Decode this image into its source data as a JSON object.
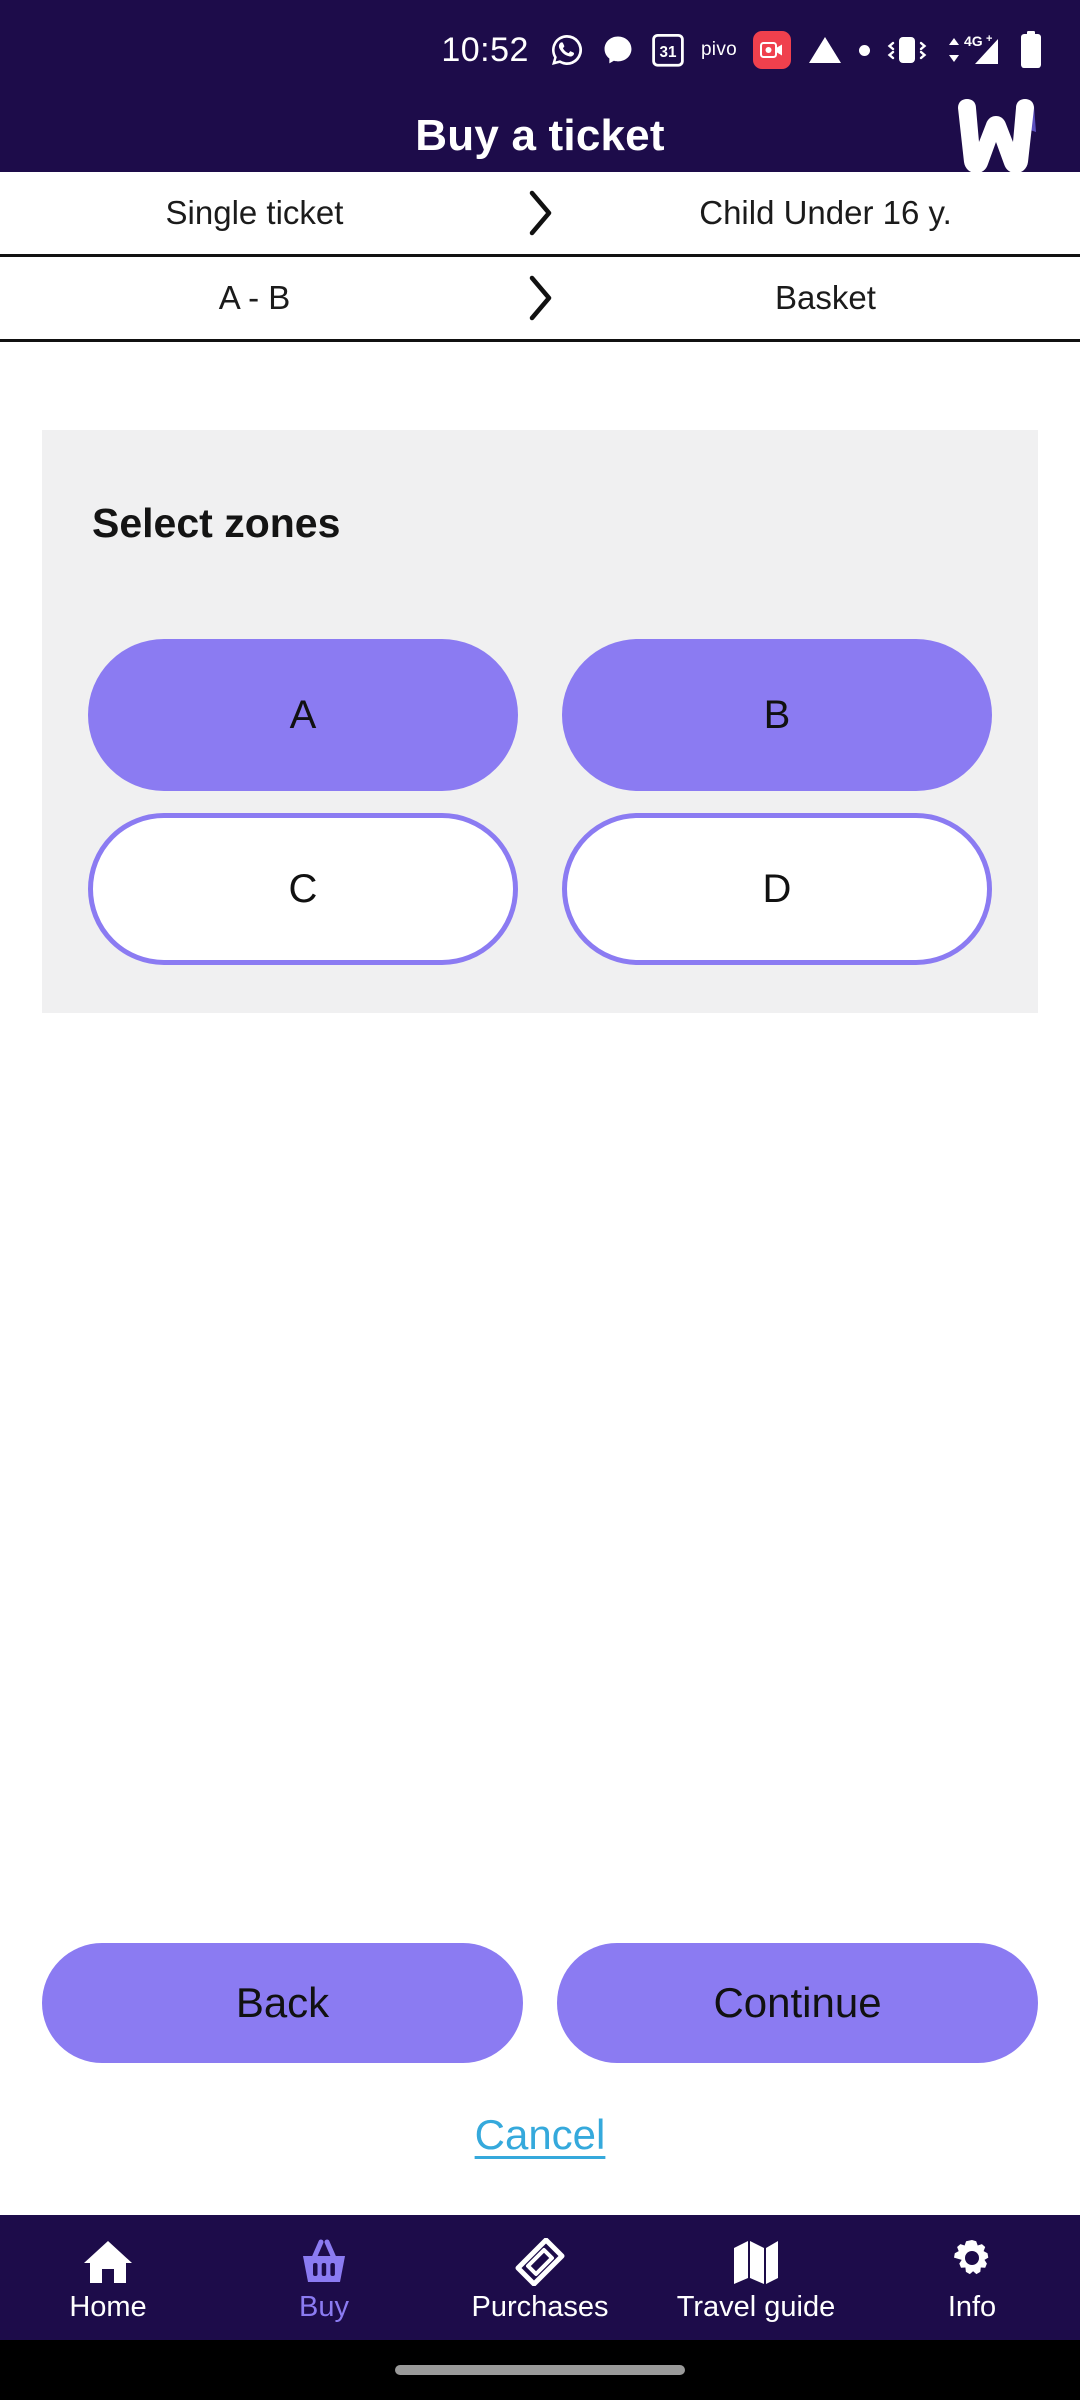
{
  "status_bar": {
    "time": "10:52",
    "pivo_label": "pivo",
    "icons": [
      "whatsapp-icon",
      "messenger-icon",
      "calendar-31-icon",
      "pivo-label",
      "screen-record-icon",
      "triangle-icon",
      "dot-icon",
      "vibrate-icon",
      "signal-4g-plus-icon",
      "battery-icon"
    ],
    "network": "4G+"
  },
  "app_bar": {
    "title": "Buy a ticket",
    "logo": "w-logo"
  },
  "breadcrumbs": [
    {
      "left": "Single ticket",
      "right": "Child Under 16 y."
    },
    {
      "left": "A - B",
      "right": "Basket"
    }
  ],
  "zones_card": {
    "title": "Select zones",
    "zones": [
      {
        "label": "A",
        "selected": true
      },
      {
        "label": "B",
        "selected": true
      },
      {
        "label": "C",
        "selected": false
      },
      {
        "label": "D",
        "selected": false
      }
    ]
  },
  "actions": {
    "back_label": "Back",
    "continue_label": "Continue",
    "cancel_label": "Cancel"
  },
  "bottom_nav": [
    {
      "label": "Home",
      "icon": "home-icon",
      "active": false
    },
    {
      "label": "Buy",
      "icon": "basket-icon",
      "active": true
    },
    {
      "label": "Purchases",
      "icon": "ticket-icon",
      "active": false
    },
    {
      "label": "Travel guide",
      "icon": "map-icon",
      "active": false
    },
    {
      "label": "Info",
      "icon": "gear-icon",
      "active": false
    }
  ],
  "colors": {
    "header_bg": "#1d0c4a",
    "accent_purple": "#8b7bf2",
    "card_bg": "#f0f0f1",
    "link_blue": "#35a9dc",
    "record_red": "#f0404d"
  }
}
